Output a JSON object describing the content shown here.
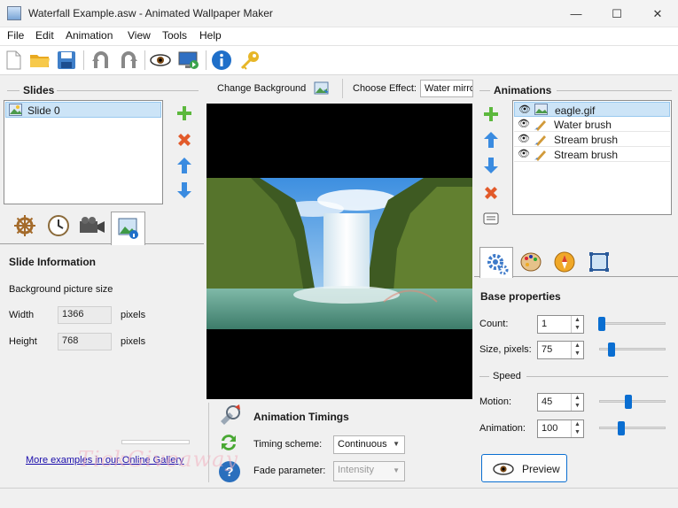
{
  "window": {
    "title": "Waterfall Example.asw - Animated Wallpaper Maker",
    "minimize": "—",
    "maximize": "☐",
    "close": "✕"
  },
  "menu": [
    "File",
    "Edit",
    "Animation",
    "View",
    "Tools",
    "Help"
  ],
  "toolbar": {
    "items": [
      "new-file",
      "open-folder",
      "save",
      "undo",
      "redo",
      "preview-eye",
      "set-wallpaper",
      "info",
      "key"
    ]
  },
  "slides": {
    "title": "Slides",
    "items": [
      "Slide 0"
    ],
    "tabs": [
      "settings-wheel",
      "clock",
      "camera",
      "image-info"
    ]
  },
  "slide_info": {
    "title": "Slide Information",
    "bg_size_label": "Background picture size",
    "width_label": "Width",
    "width_value": "1366",
    "height_label": "Height",
    "height_value": "768",
    "unit": "pixels",
    "gallery_link": "More examples in our Online Gallery"
  },
  "center": {
    "change_bg": "Change Background",
    "choose_effect_label": "Choose Effect:",
    "effect_value": "Water mirro"
  },
  "timings": {
    "title": "Animation Timings",
    "scheme_label": "Timing scheme:",
    "scheme_value": "Continuous",
    "fade_label": "Fade parameter:",
    "fade_value": "Intensity"
  },
  "animations": {
    "title": "Animations",
    "items": [
      "eagle.gif",
      "Water brush",
      "Stream brush",
      "Stream brush"
    ]
  },
  "props": {
    "base_title": "Base properties",
    "count_label": "Count:",
    "count_value": "1",
    "size_label": "Size, pixels:",
    "size_value": "75",
    "speed_title": "Speed",
    "motion_label": "Motion:",
    "motion_value": "45",
    "anim_label": "Animation:",
    "anim_value": "100",
    "preview": "Preview"
  },
  "watermark": "TickGiveaway",
  "colors": {
    "accent": "#0a6ed1",
    "link": "#1a0dab",
    "selection": "#cce4f7"
  }
}
